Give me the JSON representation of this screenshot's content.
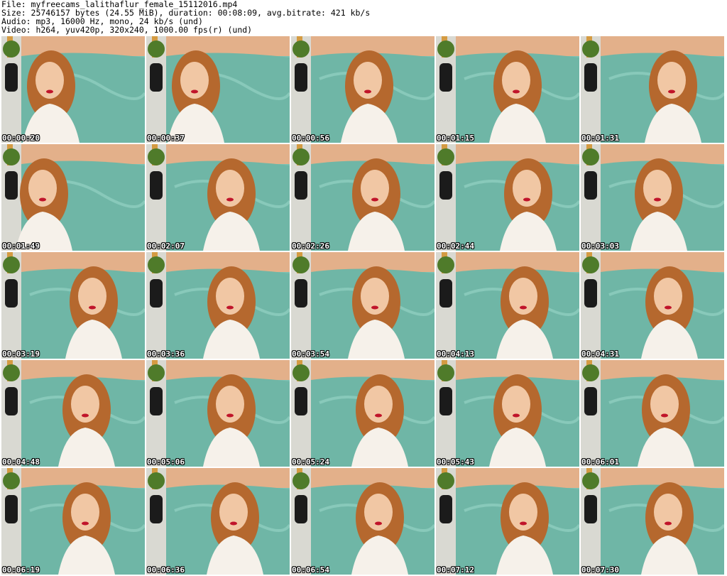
{
  "header": {
    "line1": "File: myfreecams_lalithaflur_female_15112016.mp4",
    "line2": "Size: 25746157 bytes (24.55 MiB), duration: 00:08:09, avg.bitrate: 421 kb/s",
    "line3": "Audio: mp3, 16000 Hz, mono, 24 kb/s (und)",
    "line4": "Video: h264, yuv420p, 320x240, 1000.00 fps(r) (und)"
  },
  "thumbnails": [
    {
      "timestamp": "00:00:20"
    },
    {
      "timestamp": "00:00:37"
    },
    {
      "timestamp": "00:00:56"
    },
    {
      "timestamp": "00:01:15"
    },
    {
      "timestamp": "00:01:31"
    },
    {
      "timestamp": "00:01:49"
    },
    {
      "timestamp": "00:02:07"
    },
    {
      "timestamp": "00:02:26"
    },
    {
      "timestamp": "00:02:44"
    },
    {
      "timestamp": "00:03:03"
    },
    {
      "timestamp": "00:03:19"
    },
    {
      "timestamp": "00:03:36"
    },
    {
      "timestamp": "00:03:54"
    },
    {
      "timestamp": "00:04:13"
    },
    {
      "timestamp": "00:04:31"
    },
    {
      "timestamp": "00:04:48"
    },
    {
      "timestamp": "00:05:06"
    },
    {
      "timestamp": "00:05:24"
    },
    {
      "timestamp": "00:05:43"
    },
    {
      "timestamp": "00:06:01"
    },
    {
      "timestamp": "00:06:19"
    },
    {
      "timestamp": "00:06:36"
    },
    {
      "timestamp": "00:06:54"
    },
    {
      "timestamp": "00:07:12"
    },
    {
      "timestamp": "00:07:30"
    }
  ]
}
